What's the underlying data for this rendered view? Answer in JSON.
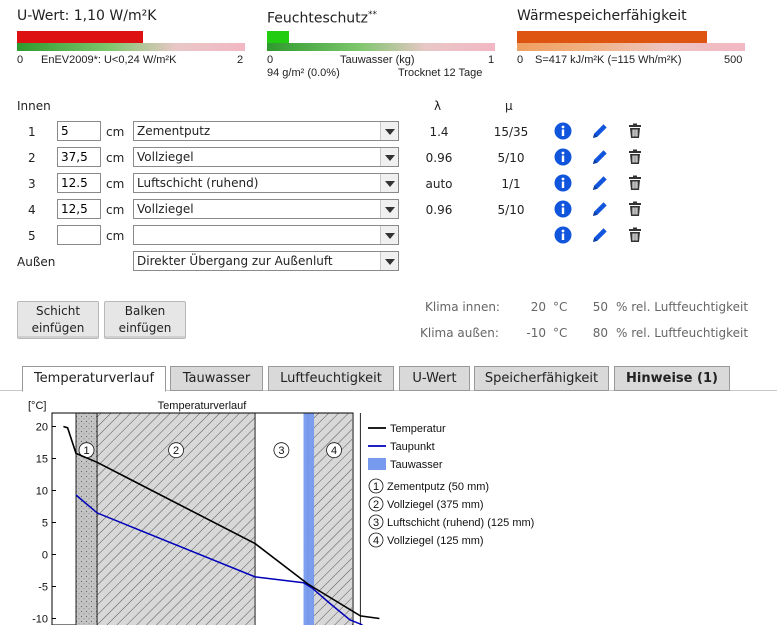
{
  "indicators": {
    "uwert": {
      "title": "U-Wert: 1,10 W/m²K",
      "scale_min": "0",
      "scale_label": "EnEV2009*: U<0,24 W/m²K",
      "scale_max": "2",
      "level": 0.55
    },
    "feuchte": {
      "title": "Feuchteschutz",
      "title_sup": "**",
      "scale_min": "0",
      "scale_label": "Tauwasser (kg)",
      "scale_max": "1",
      "sub_left": "94 g/m² (0.0%)",
      "sub_right": "Trocknet 12 Tage",
      "level": 0.1
    },
    "speicher": {
      "title": "Wärmespeicherfähigkeit",
      "scale_min": "0",
      "scale_label": "S=417 kJ/m²K (=115 Wh/m²K)",
      "scale_max": "500",
      "level": 0.83
    }
  },
  "table": {
    "innen_label": "Innen",
    "aussen_label": "Außen",
    "lambda_header": "λ",
    "mu_header": "μ",
    "unit": "cm",
    "rows": [
      {
        "nr": "1",
        "thickness": "5",
        "material": "Zementputz",
        "lambda": "1.4",
        "mu": "15/35"
      },
      {
        "nr": "2",
        "thickness": "37,5",
        "material": "Vollziegel",
        "lambda": "0.96",
        "mu": "5/10"
      },
      {
        "nr": "3",
        "thickness": "12.5",
        "material": "Luftschicht (ruhend)",
        "lambda": "auto",
        "mu": "1/1"
      },
      {
        "nr": "4",
        "thickness": "12,5",
        "material": "Vollziegel",
        "lambda": "0.96",
        "mu": "5/10"
      },
      {
        "nr": "5",
        "thickness": "",
        "material": "",
        "lambda": "",
        "mu": ""
      }
    ],
    "aussen_select": "Direkter Übergang zur Außenluft"
  },
  "buttons": {
    "schicht": [
      "Schicht",
      "einfügen"
    ],
    "balken": [
      "Balken",
      "einfügen"
    ]
  },
  "climate": {
    "innen_label": "Klima innen:",
    "innen_temp": "20",
    "innen_hum": "50",
    "aussen_label": "Klima außen:",
    "aussen_temp": "-10",
    "aussen_hum": "80",
    "temp_unit": "°C",
    "hum_unit": "% rel. Luftfeuchtigkeit"
  },
  "tabs": [
    {
      "label": "Temperaturverlauf",
      "active": true
    },
    {
      "label": "Tauwasser",
      "active": false
    },
    {
      "label": "Luftfeuchtigkeit",
      "active": false
    },
    {
      "label": "U-Wert",
      "active": false
    },
    {
      "label": "Speicherfähigkeit",
      "active": false
    },
    {
      "label": "Hinweise (1)",
      "active": false
    }
  ],
  "colors": {
    "uwert_bar": "#dd1111",
    "feuchte_bar": "#22cc11",
    "speicher_bar": "#dd5511",
    "temperature_line": "#000000",
    "dewpoint_line": "#0000bb",
    "condensate": "#7799ee",
    "info_icon": "#1155dd",
    "edit_icon": "#1155dd"
  },
  "icons": [
    "info-icon",
    "pencil-icon",
    "trash-icon"
  ],
  "chart_data": {
    "type": "line",
    "title": "Temperaturverlauf",
    "ylabel": "[°C]",
    "ylim": [
      -11,
      21
    ],
    "yticks": [
      20,
      15,
      10,
      5,
      0,
      -5,
      -10
    ],
    "xlim": [
      0,
      550
    ],
    "layer_boundaries_mm": [
      0,
      50,
      425,
      550,
      675
    ],
    "layers": [
      {
        "nr": "1",
        "label": "Zementputz (50 mm)"
      },
      {
        "nr": "2",
        "label": "Vollziegel (375 mm)"
      },
      {
        "nr": "3",
        "label": "Luftschicht (ruhend) (125 mm)"
      },
      {
        "nr": "4",
        "label": "Vollziegel (125 mm)"
      }
    ],
    "condensate_zone_mm": [
      540,
      565
    ],
    "series": [
      {
        "name": "Temperatur",
        "x": [
          -30,
          -20,
          0,
          50,
          425,
          550,
          675,
          720
        ],
        "y": [
          20,
          19.8,
          15.8,
          14.4,
          1.7,
          -4.6,
          -9.6,
          -10
        ]
      },
      {
        "name": "Taupunkt",
        "x": [
          0,
          50,
          425,
          540,
          560,
          600,
          650,
          680
        ],
        "y": [
          9.3,
          6.5,
          -3.5,
          -4.4,
          -5.2,
          -7.5,
          -10.2,
          -11
        ]
      }
    ],
    "legend": [
      "Temperatur",
      "Taupunkt",
      "Tauwasser"
    ],
    "grid": false,
    "legend_position": "right"
  }
}
